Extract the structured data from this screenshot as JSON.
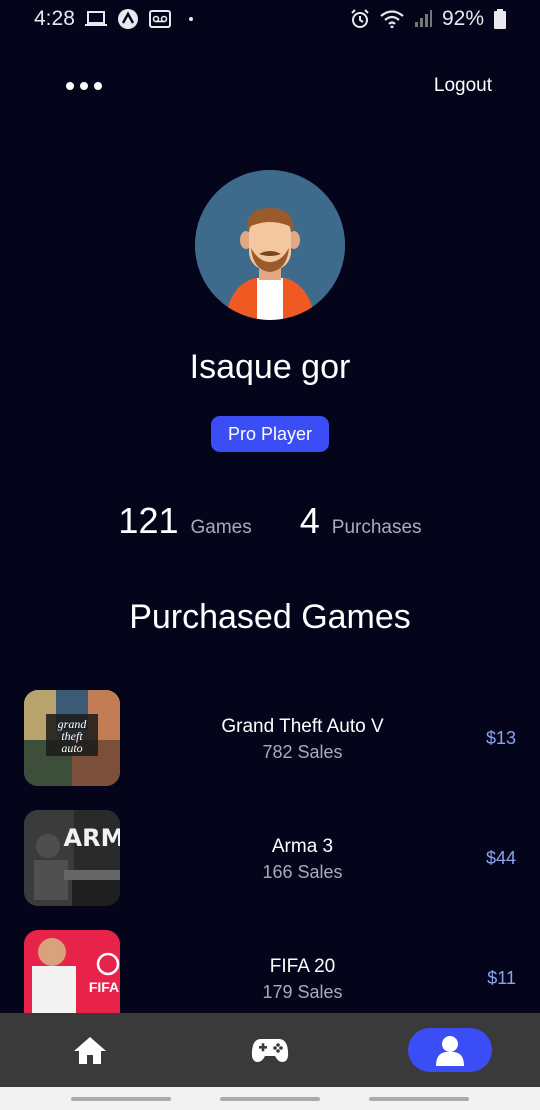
{
  "status_bar": {
    "time": "4:28",
    "battery": "92%"
  },
  "header": {
    "more_icon": "more-horizontal-icon",
    "logout_label": "Logout"
  },
  "profile": {
    "name": "Isaque gor",
    "badge": "Pro Player",
    "games_count": "121",
    "games_label": "Games",
    "purchases_count": "4",
    "purchases_label": "Purchases"
  },
  "section_title": "Purchased Games",
  "games": [
    {
      "title": "Grand Theft Auto V",
      "sales": "782 Sales",
      "price": "$13"
    },
    {
      "title": "Arma 3",
      "sales": "166 Sales",
      "price": "$44"
    },
    {
      "title": "FIFA 20",
      "sales": "179 Sales",
      "price": "$11"
    }
  ],
  "nav": {
    "items": [
      "home-icon",
      "gamepad-icon",
      "user-icon"
    ],
    "active": "user-icon"
  },
  "colors": {
    "background": "#04051a",
    "accent": "#3b4ef5",
    "price": "#8ea3ef",
    "muted_text": "#a9abb8",
    "nav_bg": "#3a3a3a"
  }
}
